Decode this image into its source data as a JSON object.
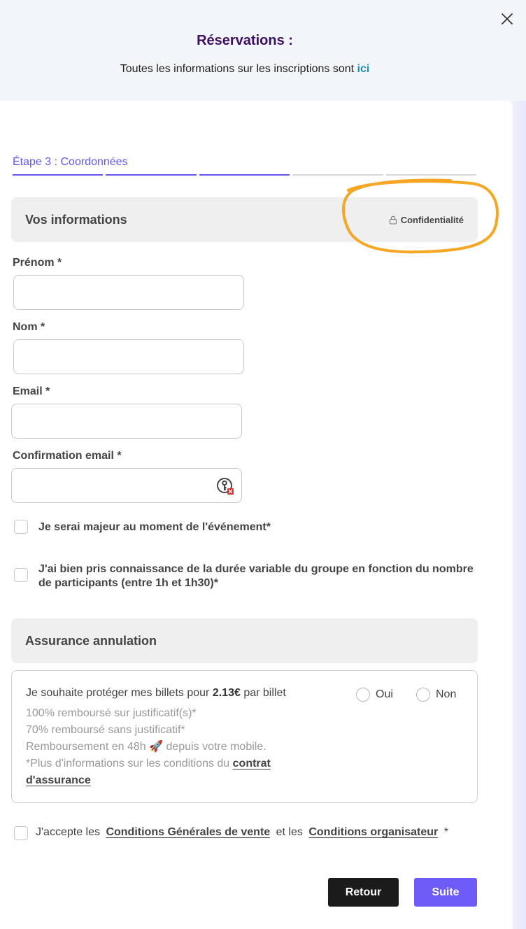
{
  "header": {
    "title": "Réservations :",
    "subtitle": "Toutes les informations sur les inscriptions sont",
    "subtitle_link": "ici"
  },
  "close_icon": "close-icon",
  "step": {
    "label": "Étape 3 : Coordonnées",
    "total": 5,
    "completed": 3
  },
  "info_section": {
    "title": "Vos informations",
    "privacy_label": "Confidentialité",
    "privacy_icon": "lock-icon"
  },
  "fields": {
    "first_name": {
      "label": "Prénom *",
      "value": ""
    },
    "last_name": {
      "label": "Nom *",
      "value": ""
    },
    "email": {
      "label": "Email *",
      "value": ""
    },
    "email_confirm": {
      "label": "Confirmation email *",
      "value": ""
    }
  },
  "checkboxes": {
    "adult": "Je serai majeur au moment de l'événement*",
    "duration": "J'ai bien pris connaissance de la durée variable du groupe en fonction du nombre de participants (entre 1h et 1h30)*"
  },
  "insurance": {
    "title": "Assurance annulation",
    "main_prefix": "Je souhaite protéger mes billets pour",
    "price": "2.13€",
    "main_suffix": "par billet",
    "line1": "100% remboursé sur justificatif(s)*",
    "line2": "70% remboursé sans justificatif*",
    "line3_prefix": "Remboursement en 48h",
    "line3_emoji": "🚀",
    "line3_suffix": "depuis votre mobile.",
    "line4_prefix": "*Plus d'informations sur les conditions du",
    "contract_link": "contrat d'assurance",
    "option_yes": "Oui",
    "option_no": "Non"
  },
  "terms": {
    "prefix": "J'accepte les",
    "cgv_link": "Conditions Générales de vente",
    "middle": "et les",
    "organizer_link": "Conditions organisateur",
    "suffix": "*"
  },
  "buttons": {
    "back": "Retour",
    "next": "Suite"
  },
  "colors": {
    "accent": "#6357f0",
    "title": "#3d0f63",
    "link": "#1b8fb4",
    "highlight": "#f5a623",
    "next_button": "#6d5bf7",
    "back_button": "#1b1b1b"
  }
}
